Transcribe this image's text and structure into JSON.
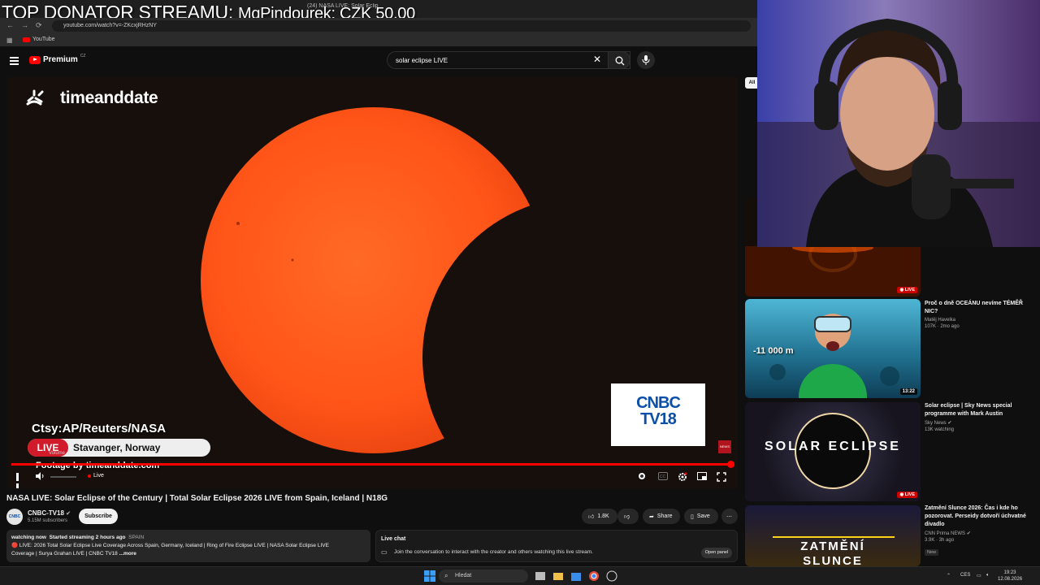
{
  "overlay": {
    "donor_label": "TOP DONATOR STREAMU:",
    "donor_value": "MgPindourek: CZK 50.00"
  },
  "browser": {
    "active_tab": "(24) NASA LIVE: Solar Eclip",
    "url": "youtube.com/watch?v=-ZKcxjRHzNY",
    "bookmark": "YouTube"
  },
  "masthead": {
    "logo": "Premium",
    "country": "CZ",
    "search_value": "solar eclipse LIVE"
  },
  "player": {
    "brand": "timeanddate",
    "credit": "Ctsy:AP/Reuters/NASA",
    "live_label": "LIVE",
    "location": "Stavanger, Norway",
    "footage": "Footage by timeanddate.com",
    "cnbc_line1": "CNBC",
    "cnbc_line2": "TV18",
    "news_badge": "NEWS",
    "volume_tooltip": "Volume",
    "live_indicator": "Live",
    "progress": 1.0
  },
  "video": {
    "title": "NASA LIVE: Solar Eclipse of the Century | Total Solar Eclipse 2026 LIVE from Spain, Iceland | N18G",
    "channel_avatar": "CNBC TV18",
    "channel": "CNBC-TV18",
    "subscribers": "5.15M subscribers",
    "subscribe": "Subscribe",
    "likes": "1.8K",
    "share": "Share",
    "save": "Save",
    "desc_watching": "watching now",
    "desc_started": "Started streaming 2 hours ago",
    "desc_region": "SPAIN",
    "desc_line1": "🔴 LIVE: 2026 Total Solar Eclipse Live Coverage Across Spain, Germany, Iceland | Ring of Fire Eclipse LIVE | NASA Solar Eclipse LIVE",
    "desc_line2": "Coverage | Surya Grahan LIVE | CNBC TV18",
    "desc_more": "...more"
  },
  "chat": {
    "title": "Live chat",
    "join": "Join the conversation to interact with the creator and others watching this live stream.",
    "open_panel": "Open panel"
  },
  "sidebar": {
    "chip": "All",
    "recs": [
      {
        "title": "",
        "channel": "",
        "meta": "",
        "badge": "LIVE"
      },
      {
        "title": "Proč o dně OCEÁNU nevíme TÉMĚŘ NIC?",
        "channel": "Matěj Havelka",
        "meta": "107K · 2mo ago",
        "badge": "13:22",
        "thumb_text": "-11 000 m"
      },
      {
        "title": "Solar eclipse | Sky News special programme with Mark Austin",
        "channel": "Sky News",
        "meta": "13K watching",
        "badge": "LIVE",
        "thumb_text": "SOLAR ECLIPSE"
      },
      {
        "title": "Zatmění Slunce 2026: Čas i kde ho pozorovat. Perseidy dotvoří úchvatné divadlo",
        "channel": "CNN Prima NEWS",
        "meta": "3.9K · 3h ago",
        "badge": "New",
        "thumb_text1": "ZATMĚNÍ",
        "thumb_text2": "SLUNCE"
      }
    ]
  },
  "taskbar": {
    "search": "Hledat",
    "lang": "CES",
    "time": "19:23",
    "date": "12.08.2026"
  },
  "colors": {
    "youtube_red": "#ff0000",
    "sun": "#ff5a1f",
    "live_red": "#d11a2a",
    "cnbc_blue": "#0b4fa8"
  }
}
